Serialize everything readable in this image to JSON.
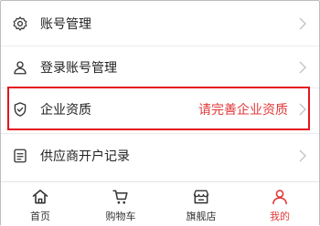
{
  "menu": {
    "items": [
      {
        "label": "账号管理",
        "icon": "gear-icon"
      },
      {
        "label": "登录账号管理",
        "icon": "user-icon"
      },
      {
        "label": "企业资质",
        "icon": "shield-check-icon",
        "hint": "请完善企业资质"
      },
      {
        "label": "供应商开户记录",
        "icon": "document-list-icon"
      }
    ]
  },
  "tabbar": {
    "tabs": [
      {
        "label": "首页",
        "icon": "home-icon",
        "active": false
      },
      {
        "label": "购物车",
        "icon": "cart-icon",
        "active": false
      },
      {
        "label": "旗舰店",
        "icon": "store-icon",
        "active": false
      },
      {
        "label": "我的",
        "icon": "profile-icon",
        "active": true
      }
    ]
  },
  "colors": {
    "accent": "#e0393b",
    "highlight_border": "#e4161f",
    "text": "#222222",
    "separator": "#ececec"
  }
}
